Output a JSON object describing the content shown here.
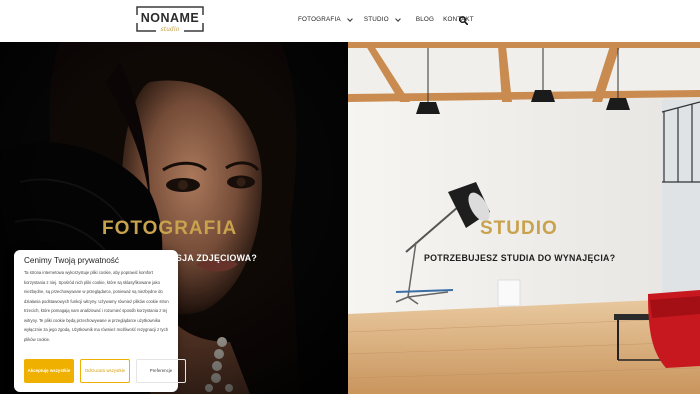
{
  "logo": {
    "main": "NONAME",
    "sub": "studio"
  },
  "nav": {
    "items": [
      {
        "label": "FOTOGRAFIA",
        "dropdown": true
      },
      {
        "label": "STUDIO",
        "dropdown": true
      },
      {
        "label": "BLOG",
        "dropdown": false
      },
      {
        "label": "KONTAKT",
        "dropdown": false
      }
    ]
  },
  "left_panel": {
    "title": "FOTOGRAFIA",
    "subtitle": "SJA ZDJĘCIOWA?"
  },
  "right_panel": {
    "title": "STUDIO",
    "subtitle": "POTRZEBUJESZ STUDIA DO WYNAJĘCIA?"
  },
  "cookie": {
    "title": "Cenimy Twoją prywatność",
    "text": "Ta strona internetowa wykorzystuje pliki cookie, aby poprawić komfort korzystania z niej. Spośród nich pliki cookie, które są sklasyfikowane jako niezbędne, są przechowywane w przeglądarce, ponieważ są niezbędne do działania podstawowych funkcji witryny. Używamy również plików cookie stron trzecich, które pomagają nam analizować i rozumieć sposób korzystania z tej witryny. Te pliki cookie będą przechowywane w przeglądarce użytkownika wyłącznie za jego zgodą. Użytkownik ma również możliwość rezygnacji z tych plików cookie.",
    "accept_label": "Akceptuję wszystkie",
    "reject_label": "Odrzucam wszystkie",
    "prefs_label": "Preferencje"
  },
  "colors": {
    "gold": "#c9a24e",
    "accent": "#f0b000"
  }
}
